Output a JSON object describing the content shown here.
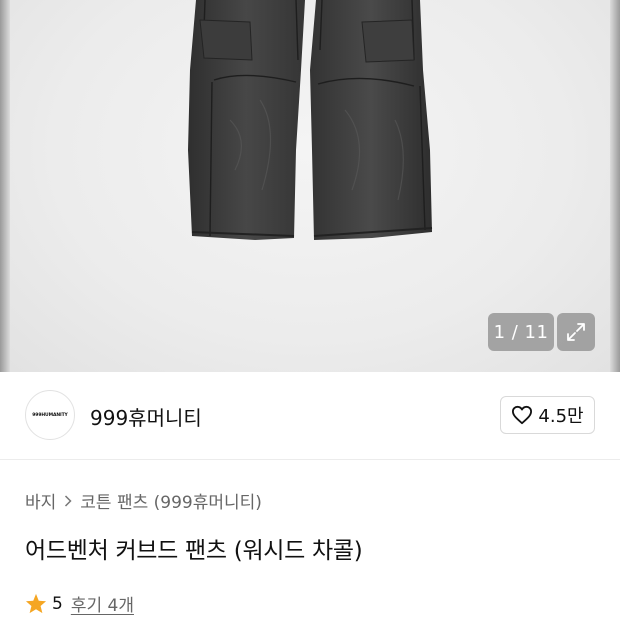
{
  "gallery": {
    "counter": "1 / 11",
    "expand_icon": "expand-icon",
    "image_alt": "charcoal washed curved cargo pants"
  },
  "brand": {
    "logo_text": "999HUMANITY",
    "name": "999휴머니티",
    "like_icon": "heart-outline-icon",
    "like_count": "4.5만"
  },
  "breadcrumb": {
    "level1": "바지",
    "level2": "코튼 팬츠 (999휴머니티)"
  },
  "product": {
    "title": "어드벤처 커브드 팬츠 (워시드 차콜)"
  },
  "rating": {
    "star_icon": "star-icon",
    "star_color": "#f5a623",
    "score": "5",
    "reviews": "후기 4개"
  }
}
